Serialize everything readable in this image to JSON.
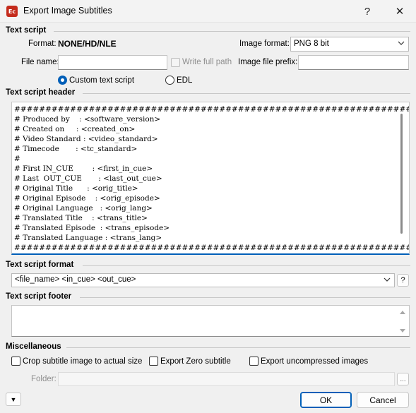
{
  "window": {
    "title": "Export Image Subtitles",
    "app_icon_text": "Ec",
    "help_glyph": "?",
    "close_glyph": "✕"
  },
  "text_script": {
    "section_title": "Text script",
    "format_label": "Format:",
    "format_value": "NONE/HD/NLE",
    "image_format_label": "Image format:",
    "image_format_value": "PNG 8 bit",
    "file_name_label": "File name:",
    "file_name_value": "",
    "write_full_path_label": "Write full path",
    "image_prefix_label": "Image file prefix:",
    "image_prefix_value": "",
    "radio_custom_label": "Custom text script",
    "radio_edl_label": "EDL",
    "selected_radio": "custom"
  },
  "header": {
    "section_title": "Text script header",
    "lines": [
      "#####################################################################",
      "# Produced by    : <software_version>",
      "# Created on     : <created_on>",
      "# Video Standard : <video_standard>",
      "# Timecode       : <tc_standard>",
      "#",
      "# First IN_CUE        : <first_in_cue>",
      "# Last  OUT_CUE       : <last_out_cue>",
      "# Original Title      : <orig_title>",
      "# Original Episode    : <orig_episode>",
      "# Original Language   : <orig_lang>",
      "# Translated Title    : <trans_title>",
      "# Translated Episode  : <trans_episode>",
      "# Translated Language : <trans_lang>",
      "#####################################################################"
    ]
  },
  "format": {
    "section_title": "Text script format",
    "value": "<file_name> <in_cue> <out_cue>",
    "help_label": "?"
  },
  "footer": {
    "section_title": "Text script footer",
    "value": ""
  },
  "misc": {
    "section_title": "Miscellaneous",
    "crop_label": "Crop subtitle image to actual size",
    "export_zero_label": "Export Zero subtitle",
    "export_uncompressed_label": "Export uncompressed images",
    "folder_label": "Folder:",
    "folder_value": "",
    "browse_label": "..."
  },
  "buttons": {
    "expand_glyph": "▼",
    "ok_label": "OK",
    "cancel_label": "Cancel"
  },
  "colors": {
    "accent": "#005fb8",
    "app_icon": "#c42b1c"
  }
}
